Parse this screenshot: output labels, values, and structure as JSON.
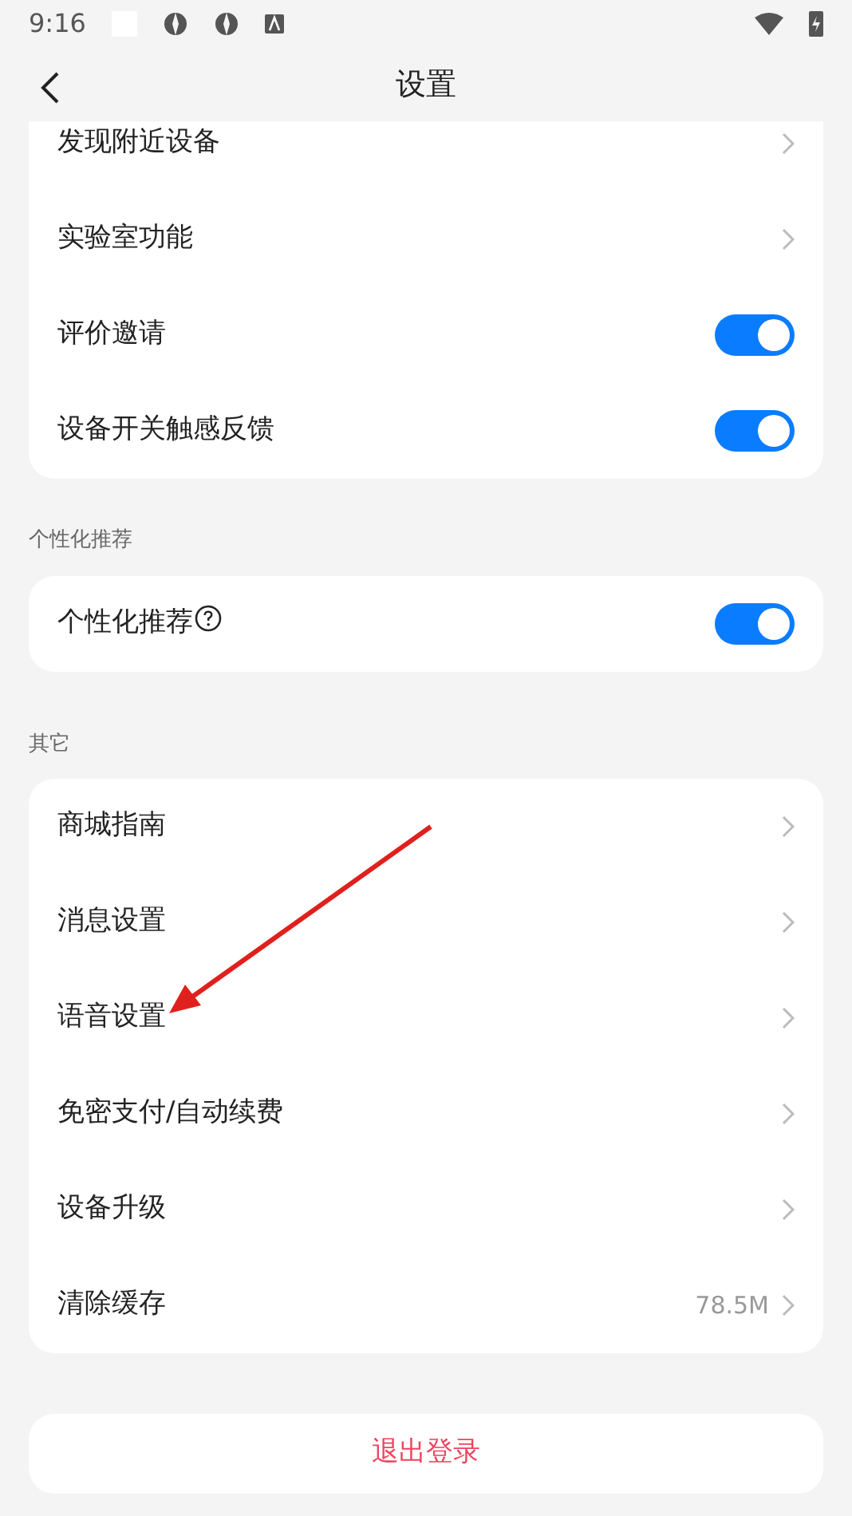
{
  "status_bar": {
    "time": "9:16"
  },
  "header": {
    "title": "设置"
  },
  "sections": [
    {
      "items": [
        {
          "label": "发现附近设备",
          "kind": "link"
        },
        {
          "label": "实验室功能",
          "kind": "link"
        },
        {
          "label": "评价邀请",
          "kind": "toggle",
          "on": true
        },
        {
          "label": "设备开关触感反馈",
          "kind": "toggle",
          "on": true
        }
      ]
    },
    {
      "label": "个性化推荐",
      "items": [
        {
          "label": "个性化推荐",
          "kind": "toggle",
          "on": true,
          "help": true
        }
      ]
    },
    {
      "label": "其它",
      "items": [
        {
          "label": "商城指南",
          "kind": "link"
        },
        {
          "label": "消息设置",
          "kind": "link"
        },
        {
          "label": "语音设置",
          "kind": "link"
        },
        {
          "label": "免密支付/自动续费",
          "kind": "link"
        },
        {
          "label": "设备升级",
          "kind": "link"
        },
        {
          "label": "清除缓存",
          "kind": "link",
          "value": "78.5M"
        }
      ]
    }
  ],
  "logout": {
    "label": "退出登录"
  }
}
